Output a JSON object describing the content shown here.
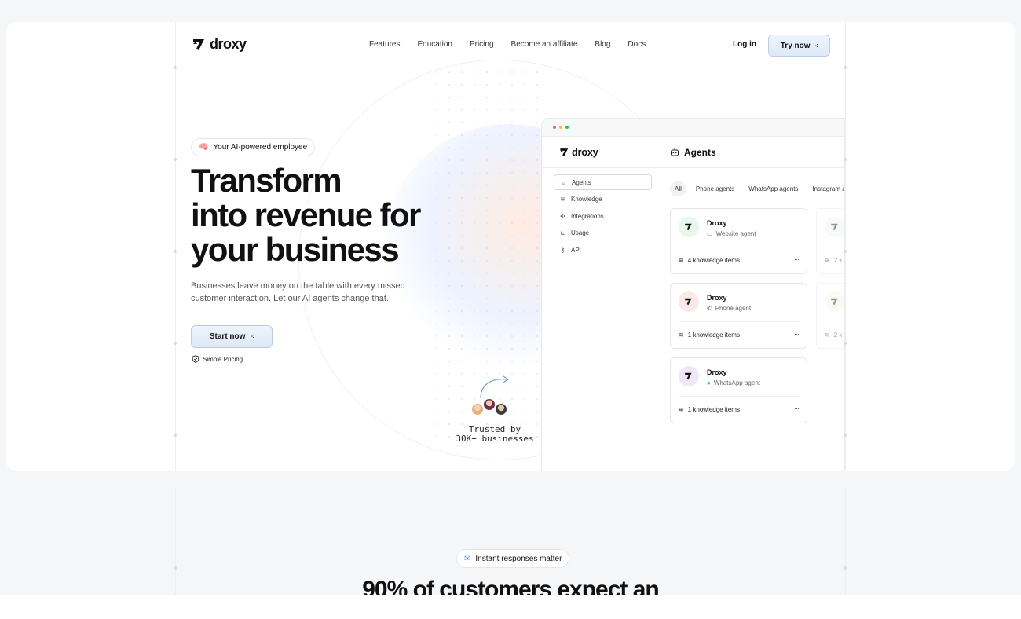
{
  "brand": {
    "name": "droxy"
  },
  "nav": {
    "links": [
      "Features",
      "Education",
      "Pricing",
      "Become an affiliate",
      "Blog",
      "Docs"
    ],
    "login": "Log in",
    "try_now": "Try now"
  },
  "hero": {
    "badge": "Your AI-powered employee",
    "headline": [
      "Transform",
      "into revenue for",
      "your business"
    ],
    "subtext": "Businesses leave money on the table with every missed customer interaction. Let our AI agents change that.",
    "cta": "Start now",
    "pricing_note": "Simple Pricing",
    "trusted": [
      "Trusted by",
      "30K+ businesses"
    ]
  },
  "app": {
    "logo": "droxy",
    "menu": [
      {
        "label": "Agents",
        "icon": "robot-icon",
        "active": true
      },
      {
        "label": "Knowledge",
        "icon": "layers-icon",
        "active": false
      },
      {
        "label": "Integrations",
        "icon": "puzzle-icon",
        "active": false
      },
      {
        "label": "Usage",
        "icon": "chart-icon",
        "active": false
      },
      {
        "label": "API",
        "icon": "key-icon",
        "active": false
      }
    ],
    "title": "Agents",
    "filters": [
      "All",
      "Phone agents",
      "WhatsApp agents",
      "Instagram a"
    ],
    "agents": [
      {
        "name": "Droxy",
        "type": "Website agent",
        "type_icon": "browser-icon",
        "knowledge": "4 knowledge items",
        "accent": "#e8f6ec"
      },
      {
        "name": "Droxy",
        "type": "Phone agent",
        "type_icon": "phone-icon",
        "knowledge": "1 knowledge items",
        "accent": "#fbe9e9"
      },
      {
        "name": "Droxy",
        "type": "WhatsApp agent",
        "type_icon": "whatsapp-icon",
        "knowledge": "1 knowledge items",
        "accent": "#efe6f8"
      }
    ],
    "ghost_knowledge": [
      "2 k",
      "2 k"
    ],
    "more": "···"
  },
  "section2": {
    "badge": "Instant responses matter",
    "heading": "90% of customers expect an"
  },
  "colors": {
    "accent_bg": "#dde9f7",
    "accent_border": "#b9cde6",
    "whatsapp": "#25d366"
  }
}
